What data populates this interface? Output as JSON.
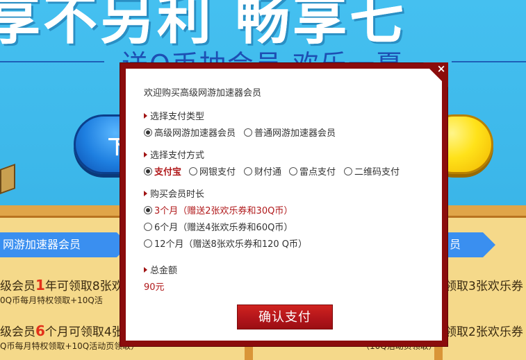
{
  "background": {
    "headline": "享不另利 畅享七",
    "subline": "送Q币抽会员 欢乐一夏",
    "blue_button_char": "下",
    "ribbon_left": "网游加速器会员",
    "ribbon_right": "员",
    "row1_left_pre": "级会员",
    "row1_left_num": "1",
    "row1_left_post": "年可领取8张欢",
    "row1_left_sub": "0Q币每月特权领取+10Q活",
    "row2_left_pre": "级会员",
    "row2_left_num": "6",
    "row2_left_post": "个月可领取4张",
    "row2_left_sub": "Q币每月特权领取+10Q活动页领取）",
    "row1_right": "领取3张欢乐券",
    "row2_right": "领取2张欢乐券",
    "row2_right_sub": "（10Q活动页领取）"
  },
  "modal": {
    "welcome": "欢迎购买高级网游加速器会员",
    "close_symbol": "×",
    "pay_type": {
      "title": "选择支付类型",
      "options": [
        "高级网游加速器会员",
        "普通网游加速器会员"
      ],
      "selected": 0
    },
    "pay_method": {
      "title": "选择支付方式",
      "options": [
        "支付宝",
        "网银支付",
        "财付通",
        "雷点支付",
        "二维码支付"
      ],
      "selected": 0
    },
    "duration": {
      "title": "购买会员时长",
      "options": [
        "3个月（赠送2张欢乐券和30Q币）",
        "6个月（赠送4张欢乐券和60Q币）",
        "12个月（赠送8张欢乐券和120 Q币）"
      ],
      "selected": 0
    },
    "total_title": "总金额",
    "total_value": "90元",
    "confirm_label": "确认支付"
  },
  "colors": {
    "modal_frame": "#8b0c0c",
    "accent_red": "#b0181a",
    "page_bg": "#3fb8ea"
  }
}
